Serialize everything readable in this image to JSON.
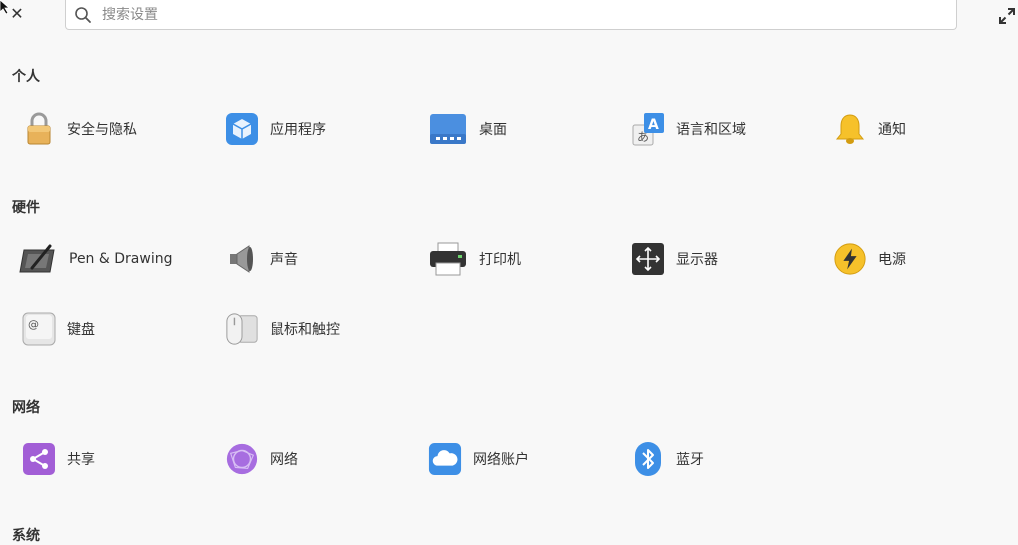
{
  "search": {
    "placeholder": "搜索设置"
  },
  "sections": [
    {
      "title": "个人",
      "items": [
        {
          "label": "安全与隐私",
          "icon": "lock-icon"
        },
        {
          "label": "应用程序",
          "icon": "applications-icon"
        },
        {
          "label": "桌面",
          "icon": "desktop-icon"
        },
        {
          "label": "语言和区域",
          "icon": "language-icon"
        },
        {
          "label": "通知",
          "icon": "bell-icon"
        }
      ]
    },
    {
      "title": "硬件",
      "items": [
        {
          "label": "Pen & Drawing",
          "icon": "tablet-pen-icon"
        },
        {
          "label": "声音",
          "icon": "speaker-icon"
        },
        {
          "label": "打印机",
          "icon": "printer-icon"
        },
        {
          "label": "显示器",
          "icon": "display-icon"
        },
        {
          "label": "电源",
          "icon": "power-icon"
        },
        {
          "label": "键盘",
          "icon": "keyboard-icon"
        },
        {
          "label": "鼠标和触控",
          "icon": "mouse-icon"
        }
      ]
    },
    {
      "title": "网络",
      "items": [
        {
          "label": "共享",
          "icon": "share-icon"
        },
        {
          "label": "网络",
          "icon": "network-icon"
        },
        {
          "label": "网络账户",
          "icon": "cloud-icon"
        },
        {
          "label": "蓝牙",
          "icon": "bluetooth-icon"
        }
      ]
    },
    {
      "title": "系统",
      "items": []
    }
  ]
}
